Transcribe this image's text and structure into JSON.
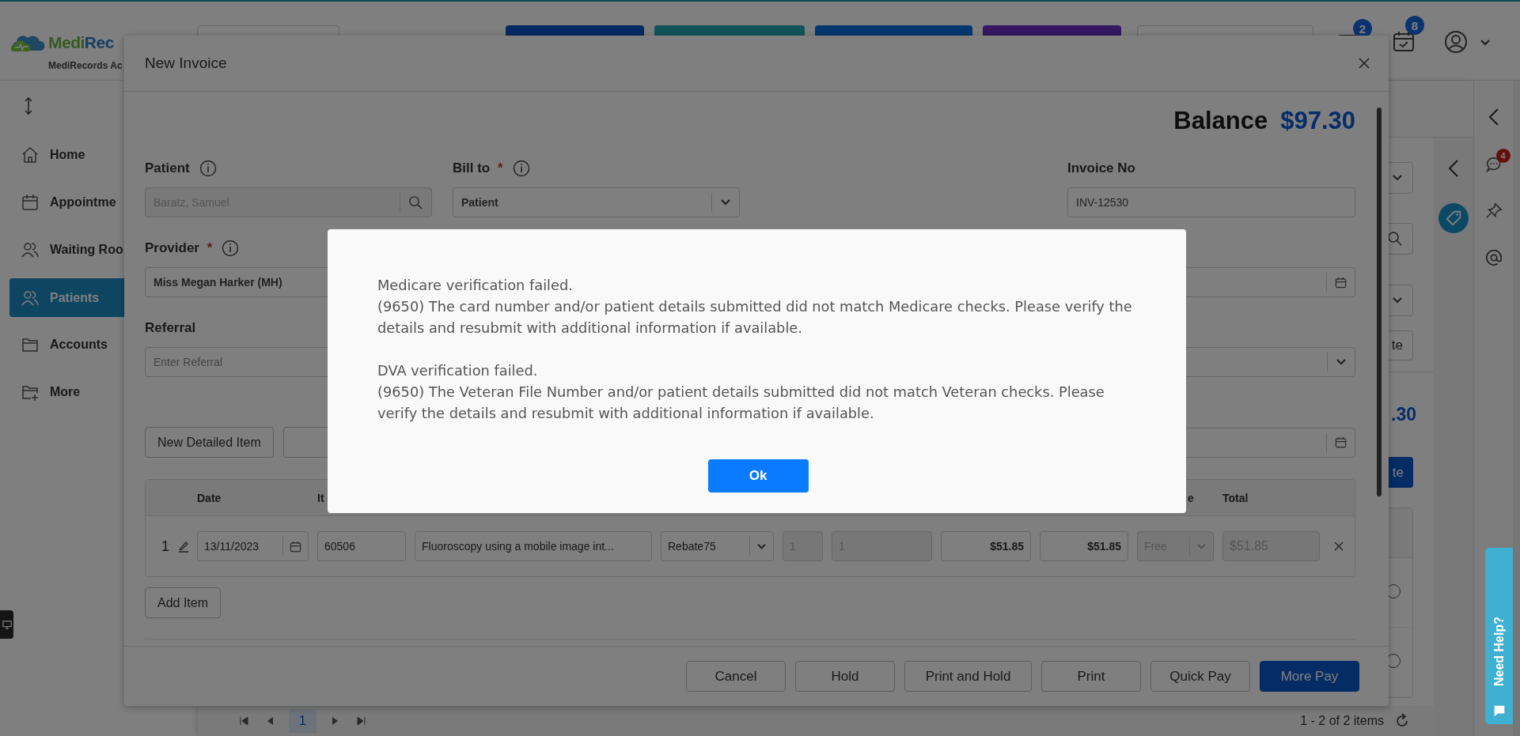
{
  "header": {
    "brand_first": "Medi",
    "brand_second": "Rec",
    "brand_caption": "MediRecords Ac",
    "alerts": [
      {
        "kind": "mail",
        "badge": "2"
      },
      {
        "kind": "calendar",
        "badge": "8"
      }
    ]
  },
  "sidebar": {
    "items": [
      {
        "kind": "home",
        "label": "Home",
        "selected": false
      },
      {
        "kind": "calendar",
        "label": "Appointme",
        "selected": false
      },
      {
        "kind": "people",
        "label": "Waiting Roo",
        "selected": false
      },
      {
        "kind": "people",
        "label": "Patients",
        "selected": true
      },
      {
        "kind": "folder",
        "label": "Accounts",
        "selected": false
      },
      {
        "kind": "folder-plus",
        "label": "More",
        "selected": false
      }
    ]
  },
  "page": {
    "panel_button": "te",
    "amount": ".30",
    "action_button": "te",
    "options": [
      {
        "selected": false
      },
      {
        "selected": false
      }
    ],
    "pager": {
      "pages": [
        {
          "label": "1",
          "selected": true
        }
      ],
      "summary": "1 - 2 of 2 items"
    }
  },
  "right_rail": {
    "chat_badge": "4"
  },
  "help_tab": {
    "label": "Need Help?"
  },
  "invoice": {
    "title": "New Invoice",
    "balance_label": "Balance",
    "balance": "$97.30",
    "patient": {
      "label": "Patient",
      "value": "Baratz, Samuel",
      "disabled": true
    },
    "bill_to": {
      "label": "Bill to",
      "required_mark": "*",
      "value": "Patient"
    },
    "invoice_no": {
      "label": "Invoice No",
      "value": "INV-12530"
    },
    "provider": {
      "label": "Provider",
      "required_mark": "*",
      "value": "Miss Megan Harker (MH)"
    },
    "referral": {
      "label": "Referral",
      "placeholder": "Enter Referral"
    },
    "new_item_button": "New Detailed Item",
    "table": {
      "columns": {
        "date": "Date",
        "item": "It",
        "column_11": "e",
        "total": "Total"
      },
      "rows": [
        {
          "number": "1",
          "date": "13/11/2023",
          "item": "60506",
          "description": "Fluoroscopy using a mobile image int...",
          "rebate": "Rebate75",
          "column_7": "1",
          "column_8": "1",
          "column_9": "$51.85",
          "column_10": "$51.85",
          "column_11": "Free",
          "total": "$51.85"
        }
      ]
    },
    "add_item_button": "Add Item",
    "footer_buttons": [
      {
        "label": "Cancel",
        "primary": false
      },
      {
        "label": "Hold",
        "primary": false
      },
      {
        "label": "Print and Hold",
        "primary": false
      },
      {
        "label": "Print",
        "primary": false
      },
      {
        "label": "Quick Pay",
        "primary": false
      },
      {
        "label": "More Pay",
        "primary": true
      }
    ]
  },
  "alert": {
    "paragraphs": [
      {
        "title": "Medicare verification failed.",
        "text": "(9650) The card number and/or patient details submitted did not match Medicare checks. Please verify the details and resubmit with additional information if available."
      },
      {
        "title": "DVA verification failed.",
        "text": "(9650) The Veteran File Number and/or patient details submitted did not match Veteran checks. Please verify the details and resubmit with additional information if available."
      }
    ],
    "button": "Ok"
  }
}
